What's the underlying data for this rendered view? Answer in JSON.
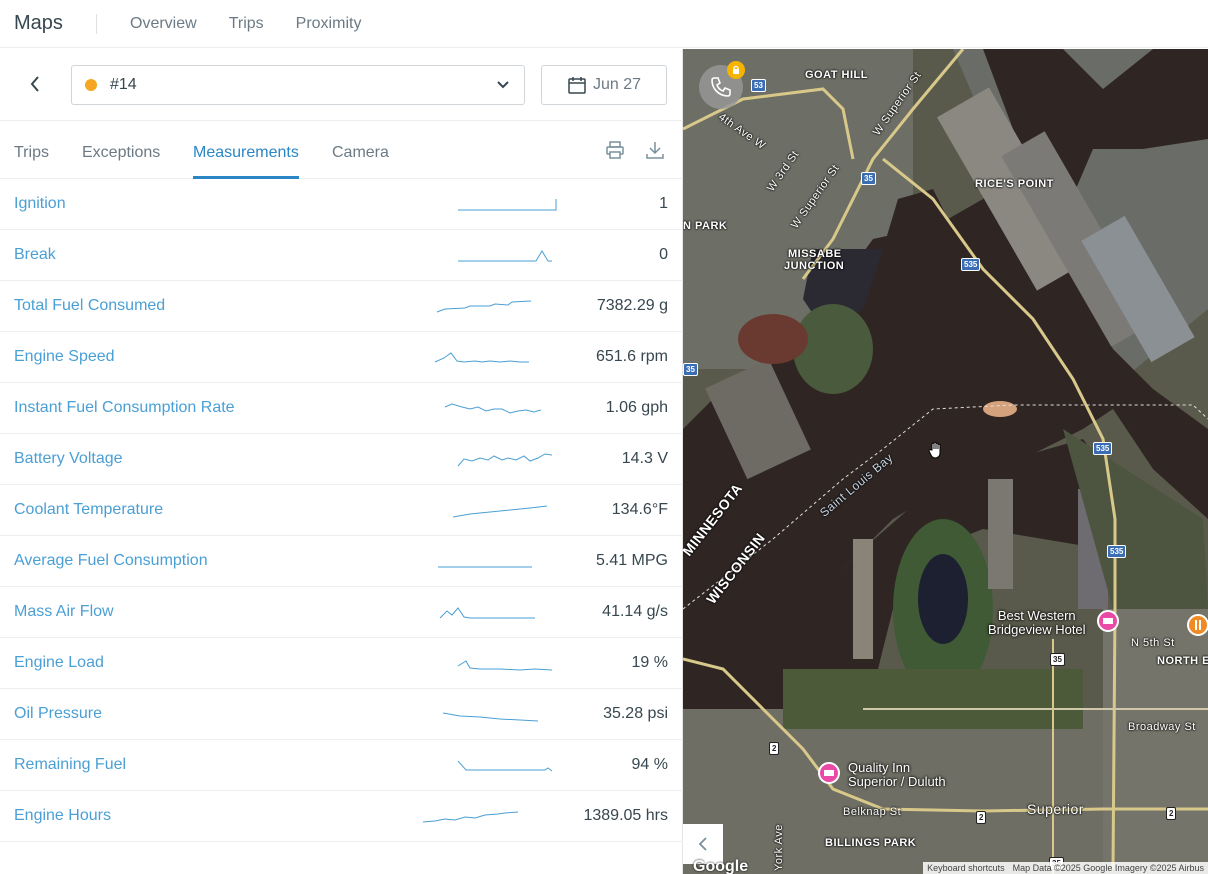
{
  "header": {
    "title": "Maps",
    "nav": [
      "Overview",
      "Trips",
      "Proximity"
    ]
  },
  "controls": {
    "vehicle": "#14",
    "vehicle_status_color": "#f5a623",
    "date": "Jun 27"
  },
  "tabs": [
    "Trips",
    "Exceptions",
    "Measurements",
    "Camera"
  ],
  "active_tab": "Measurements",
  "measurements": [
    {
      "name": "Ignition",
      "value": "1"
    },
    {
      "name": "Break",
      "value": "0"
    },
    {
      "name": "Total Fuel Consumed",
      "value": "7382.29 g"
    },
    {
      "name": "Engine Speed",
      "value": "651.6 rpm"
    },
    {
      "name": "Instant Fuel Consumption Rate",
      "value": "1.06 gph"
    },
    {
      "name": "Battery Voltage",
      "value": "14.3 V"
    },
    {
      "name": "Coolant Temperature",
      "value": "134.6°F"
    },
    {
      "name": "Average Fuel Consumption",
      "value": "5.41 MPG"
    },
    {
      "name": "Mass Air Flow",
      "value": "41.14 g/s"
    },
    {
      "name": "Engine Load",
      "value": "19 %"
    },
    {
      "name": "Oil Pressure",
      "value": "35.28 psi"
    },
    {
      "name": "Remaining Fuel",
      "value": "94 %"
    },
    {
      "name": "Engine Hours",
      "value": "1389.05 hrs"
    }
  ],
  "map": {
    "labels": {
      "goat_hill": "GOAT HILL",
      "rices_point": "RICE'S POINT",
      "park": "N PARK",
      "missabe": "MISSABE",
      "junction": "JUNCTION",
      "minnesota": "MINNESOTA",
      "wisconsin": "WISCONSIN",
      "saint_louis_bay": "Saint Louis Bay",
      "north_end": "NORTH E",
      "billings_park": "BILLINGS PARK",
      "superior": "Superior",
      "broadway": "Broadway St",
      "n5th": "N 5th St",
      "belknap": "Belknap St",
      "w_superior_st": "W Superior St",
      "w_superior_st_2": "W Superior St",
      "w_3rd_st": "W 3rd St",
      "w_4th_ave": "4th Ave W",
      "york_ave": "York Ave"
    },
    "pois": [
      {
        "name": "Best Western\nBridgeview Hotel"
      },
      {
        "name": "Quality Inn\nSuperior / Duluth"
      }
    ],
    "shields": [
      "53",
      "35",
      "535",
      "535",
      "535",
      "535",
      "35",
      "35",
      "2",
      "2",
      "2",
      "35"
    ],
    "google": "Google",
    "attribution": [
      "Keyboard shortcuts",
      "Map Data ©2025 Google Imagery ©2025 Airbus"
    ]
  }
}
